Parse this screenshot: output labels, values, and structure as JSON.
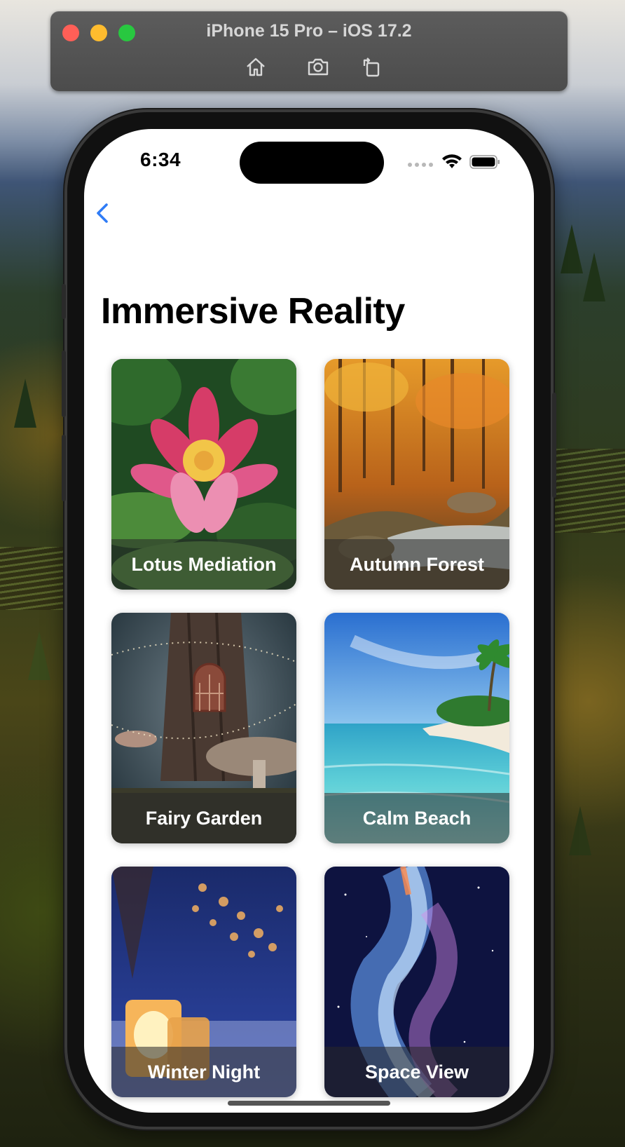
{
  "simulator": {
    "title": "iPhone 15 Pro – iOS 17.2",
    "toolbar": [
      {
        "name": "home-icon"
      },
      {
        "name": "screenshot-icon"
      },
      {
        "name": "rotate-icon"
      }
    ],
    "window_controls": [
      "close",
      "minimize",
      "zoom"
    ]
  },
  "status_bar": {
    "time": "6:34",
    "icons": [
      "signal-dots-icon",
      "wifi-icon",
      "battery-icon"
    ]
  },
  "nav": {
    "back_icon": "chevron-left-icon"
  },
  "page": {
    "title": "Immersive Reality"
  },
  "cards": [
    {
      "label": "Lotus Mediation",
      "theme": "lotus"
    },
    {
      "label": "Autumn Forest",
      "theme": "autumn"
    },
    {
      "label": "Fairy Garden",
      "theme": "fairy"
    },
    {
      "label": "Calm Beach",
      "theme": "beach"
    },
    {
      "label": "Winter Night",
      "theme": "winter"
    },
    {
      "label": "Space View",
      "theme": "space"
    }
  ],
  "colors": {
    "accent": "#2f7cf6",
    "caption_overlay": "rgba(40,40,40,0.55)"
  }
}
